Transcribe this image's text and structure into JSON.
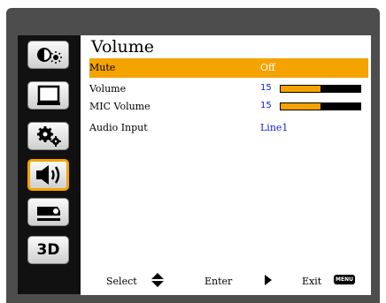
{
  "menu": {
    "title": "Volume",
    "tabs": [
      {
        "icon": "brightness-contrast-icon",
        "active": false
      },
      {
        "icon": "display-screen-icon",
        "active": false
      },
      {
        "icon": "settings-gears-icon",
        "active": false
      },
      {
        "icon": "speaker-volume-icon",
        "active": true
      },
      {
        "icon": "projector-icon",
        "active": false
      },
      {
        "icon": "3d-icon",
        "label": "3D",
        "active": false
      }
    ],
    "items": [
      {
        "label": "Mute",
        "value": "Off",
        "selected": true
      },
      {
        "label": "Volume",
        "value": "15",
        "level": 0.5
      },
      {
        "label": "MIC Volume",
        "value": "15",
        "level": 0.5
      },
      {
        "label": "Audio Input",
        "value": "Line1"
      }
    ]
  },
  "footer": {
    "select_label": "Select",
    "enter_label": "Enter",
    "exit_label": "Exit",
    "menu_badge": "MENU"
  },
  "colors": {
    "accent": "#f5a300",
    "value_text": "#1020e0",
    "frame": "#4d4d4d",
    "sidebar": "#111111"
  }
}
